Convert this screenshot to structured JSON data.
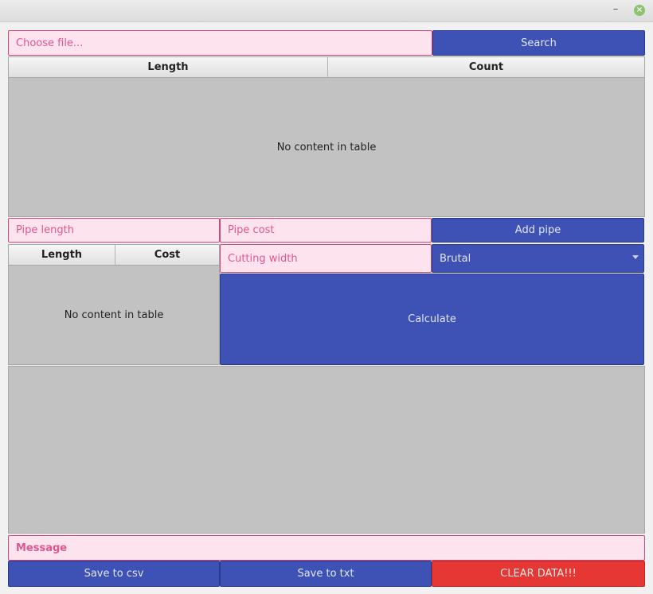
{
  "window": {
    "minimize_glyph": "–",
    "close_glyph": "×"
  },
  "file": {
    "placeholder": "Choose file...",
    "search_label": "Search"
  },
  "counts_table": {
    "columns": [
      "Length",
      "Count"
    ],
    "empty_text": "No content in table"
  },
  "pipe_inputs": {
    "length_placeholder": "Pipe length",
    "cost_placeholder": "Pipe cost",
    "add_label": "Add pipe"
  },
  "pipes_table": {
    "columns": [
      "Length",
      "Cost"
    ],
    "empty_text": "No content in table"
  },
  "cutting": {
    "placeholder": "Cutting width"
  },
  "algorithm": {
    "selected": "Brutal"
  },
  "calculate_label": "Calculate",
  "message": {
    "placeholder": "Message"
  },
  "footer": {
    "save_csv": "Save to csv",
    "save_txt": "Save to txt",
    "clear": "CLEAR DATA!!!"
  },
  "colors": {
    "primary": "#3e51b5",
    "danger": "#e53734",
    "field_bg": "#fde3ee",
    "field_border": "#d2477a",
    "panel_bg": "#c1c2c1"
  }
}
